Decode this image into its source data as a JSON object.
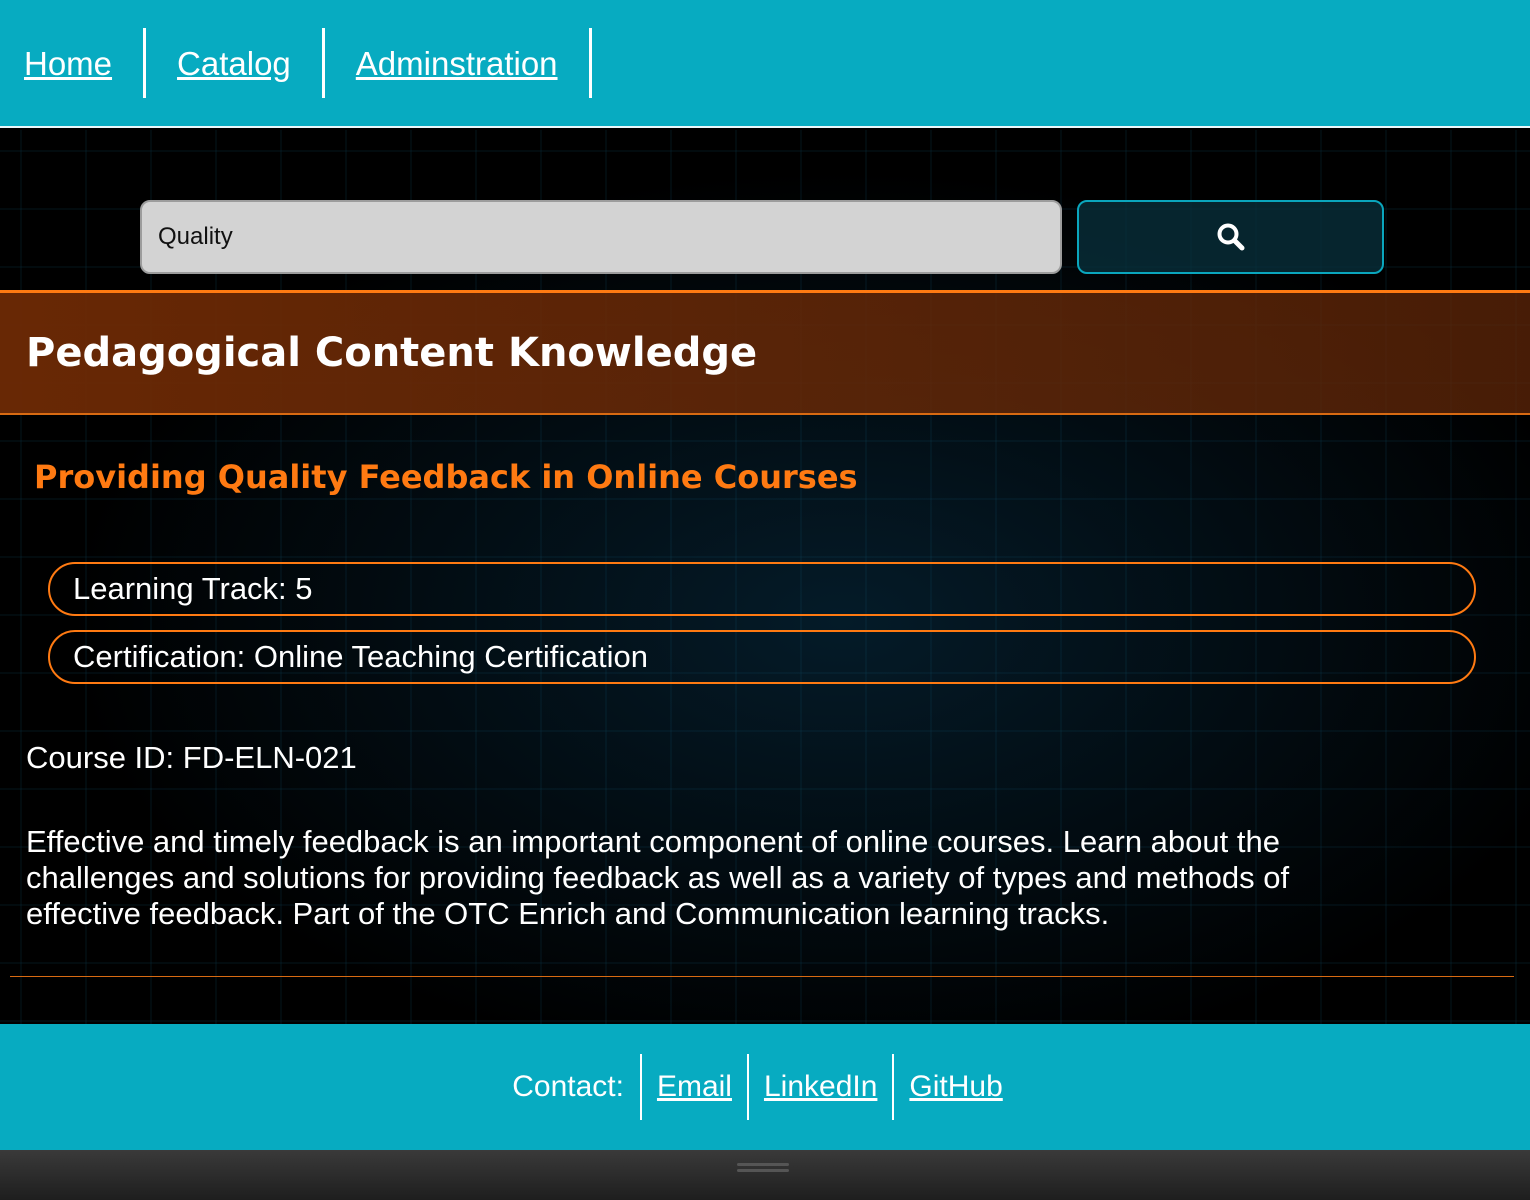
{
  "nav": {
    "items": [
      {
        "label": "Home"
      },
      {
        "label": "Catalog"
      },
      {
        "label": "Adminstration"
      }
    ]
  },
  "search": {
    "value": "Quality",
    "button_icon": "search-icon"
  },
  "category": {
    "title": "Pedagogical Content Knowledge"
  },
  "course": {
    "title": "Providing Quality Feedback in Online Courses",
    "learning_track": "Learning Track: 5",
    "certification": "Certification: Online Teaching Certification",
    "course_id": "Course ID: FD-ELN-021",
    "description": "Effective and timely feedback is an important component of online courses. Learn about the challenges and solutions for providing feedback as well as a variety of types and methods of effective feedback. Part of the OTC Enrich and Communication learning tracks."
  },
  "footer": {
    "contact_label": "Contact:",
    "links": [
      {
        "label": "Email"
      },
      {
        "label": "LinkedIn"
      },
      {
        "label": "GitHub"
      }
    ]
  },
  "colors": {
    "nav_bg": "#07abc1",
    "accent_orange": "#ff7a12",
    "search_bg": "#d3d3d3"
  }
}
